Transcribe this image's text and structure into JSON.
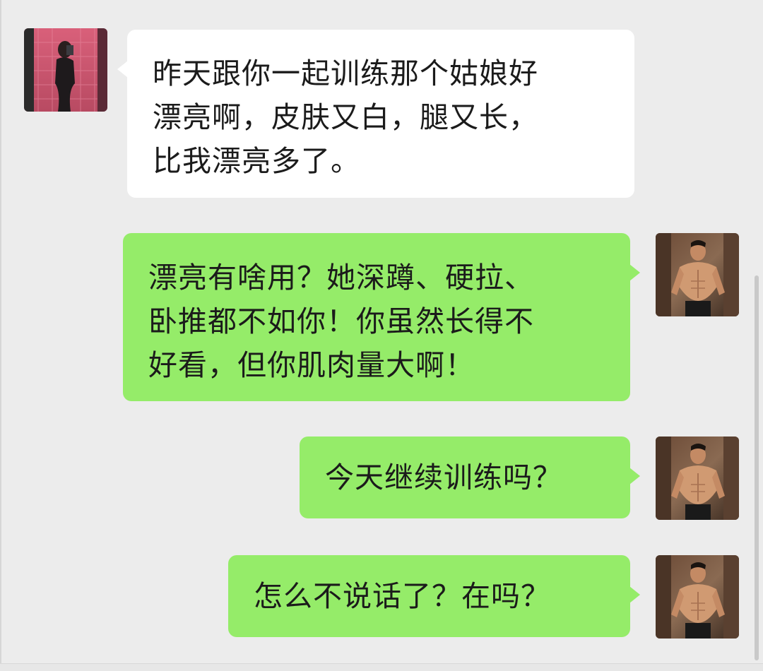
{
  "messages": [
    {
      "sender": "contact",
      "avatar": "woman-selfie-avatar",
      "text": "昨天跟你一起训练那个姑娘好\n漂亮啊，皮肤又白，腿又长，\n比我漂亮多了。"
    },
    {
      "sender": "self",
      "avatar": "muscular-man-avatar",
      "text": "漂亮有啥用？她深蹲、硬拉、\n卧推都不如你！你虽然长得不\n好看，但你肌肉量大啊！"
    },
    {
      "sender": "self",
      "avatar": "muscular-man-avatar",
      "text": "今天继续训练吗？"
    },
    {
      "sender": "self",
      "avatar": "muscular-man-avatar",
      "text": "怎么不说话了？在吗？"
    }
  ],
  "colors": {
    "background": "#ececec",
    "incoming_bubble": "#ffffff",
    "outgoing_bubble": "#95ec69",
    "text": "#1b1b1b"
  }
}
